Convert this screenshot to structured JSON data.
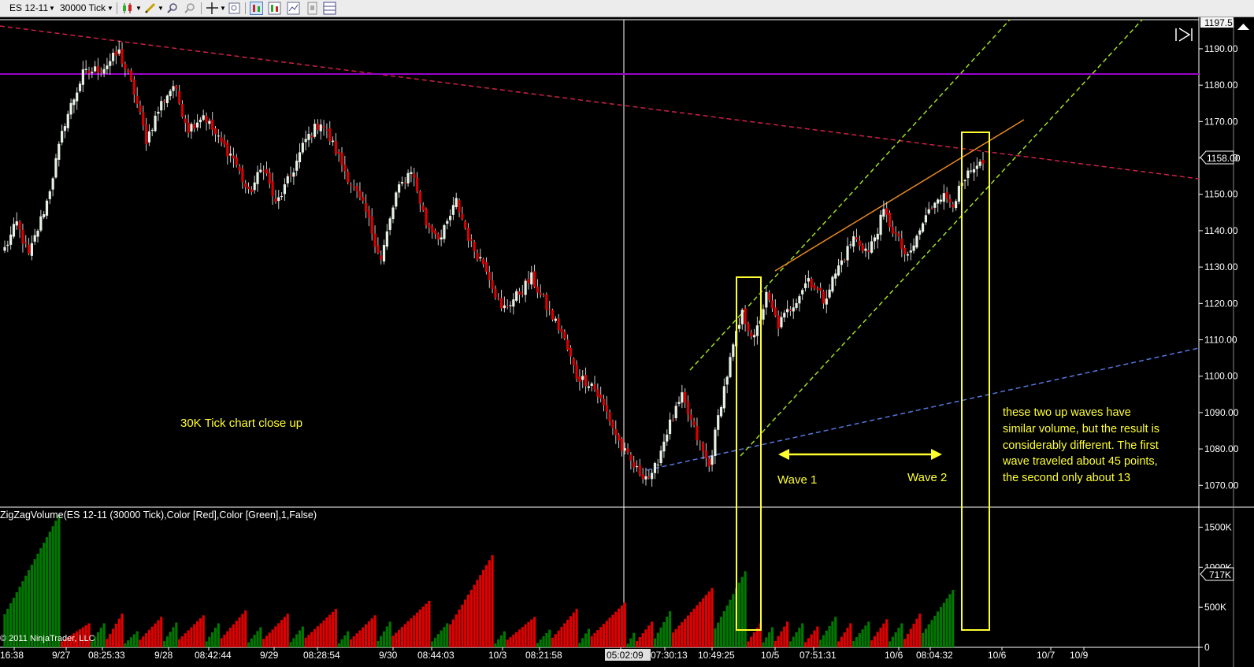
{
  "toolbar": {
    "instrument_label": "ES 12-11",
    "period_label": "30000 Tick",
    "icons": [
      "bar-style-icon",
      "draw-pencil-icon",
      "zoom-in-icon",
      "zoom-out-icon",
      "crosshair-icon",
      "data-box-icon",
      "chart-properties-icon",
      "indicators-icon",
      "strategies-icon",
      "templates-icon",
      "multi-panel-icon"
    ]
  },
  "colors": {
    "up_candle": "#e6f2e6",
    "down_candle": "#d80000",
    "vol_up": "#007800",
    "vol_down": "#e00000",
    "highlight": "#ffff30",
    "annotation_text": "#ffff30",
    "resistance_line": "#cc2244",
    "horizontal_line": "#9900cc",
    "support_line": "#5577dd",
    "channel_line": "#a0e020",
    "wedge_line": "#e88a22"
  },
  "chart_data": [
    {
      "type": "candlestick",
      "panel": "price",
      "ylim": [
        1064,
        1198
      ],
      "y_ticks": [
        "1190.00",
        "1180.00",
        "1170.00",
        "1160.00",
        "1150.00",
        "1140.00",
        "1130.00",
        "1120.00",
        "1110.00",
        "1100.00",
        "1090.00",
        "1080.00",
        "1070.00"
      ],
      "last_price_label": "1158.00",
      "top_price_label": "1197.5",
      "anchor_closes": [
        [
          0,
          1135
        ],
        [
          4,
          1142
        ],
        [
          8,
          1133
        ],
        [
          14,
          1148
        ],
        [
          20,
          1170
        ],
        [
          26,
          1183
        ],
        [
          33,
          1185
        ],
        [
          38,
          1189
        ],
        [
          43,
          1178
        ],
        [
          47,
          1165
        ],
        [
          52,
          1175
        ],
        [
          56,
          1180
        ],
        [
          61,
          1168
        ],
        [
          66,
          1172
        ],
        [
          71,
          1165
        ],
        [
          76,
          1160
        ],
        [
          81,
          1150
        ],
        [
          86,
          1158
        ],
        [
          90,
          1147
        ],
        [
          95,
          1155
        ],
        [
          100,
          1165
        ],
        [
          105,
          1170
        ],
        [
          110,
          1162
        ],
        [
          115,
          1153
        ],
        [
          120,
          1145
        ],
        [
          125,
          1132
        ],
        [
          130,
          1150
        ],
        [
          135,
          1157
        ],
        [
          140,
          1142
        ],
        [
          145,
          1138
        ],
        [
          150,
          1148
        ],
        [
          155,
          1136
        ],
        [
          160,
          1130
        ],
        [
          165,
          1118
        ],
        [
          170,
          1122
        ],
        [
          175,
          1127
        ],
        [
          180,
          1119
        ],
        [
          185,
          1112
        ],
        [
          190,
          1100
        ],
        [
          195,
          1098
        ],
        [
          200,
          1090
        ],
        [
          205,
          1080
        ],
        [
          210,
          1074
        ],
        [
          215,
          1072
        ],
        [
          220,
          1085
        ],
        [
          225,
          1094
        ],
        [
          230,
          1083
        ],
        [
          234,
          1075
        ],
        [
          238,
          1093
        ],
        [
          242,
          1108
        ],
        [
          245,
          1117
        ],
        [
          249,
          1110
        ],
        [
          253,
          1122
        ],
        [
          257,
          1114
        ],
        [
          262,
          1120
        ],
        [
          267,
          1127
        ],
        [
          272,
          1121
        ],
        [
          277,
          1130
        ],
        [
          282,
          1138
        ],
        [
          287,
          1134
        ],
        [
          292,
          1145
        ],
        [
          297,
          1137
        ],
        [
          300,
          1132
        ],
        [
          305,
          1142
        ],
        [
          310,
          1150
        ],
        [
          315,
          1148
        ],
        [
          320,
          1155
        ],
        [
          325,
          1158
        ]
      ],
      "annotations": {
        "chart_label": "30K Tick chart close up",
        "wave1": "Wave 1",
        "wave2": "Wave 2",
        "note_lines": [
          "these two up waves have",
          "similar volume, but the result is",
          "considerably different.  The first",
          "wave traveled about 45 points,",
          "the second only about 13"
        ]
      }
    },
    {
      "type": "bar",
      "panel": "volume",
      "title": "ZigZagVolume(ES 12-11 (30000 Tick),Color [Red],Color [Green],1,False)",
      "ylim": [
        0,
        1750
      ],
      "y_ticks": [
        "1500K",
        "1000K",
        "500K",
        "0"
      ],
      "y_tick_values": [
        1500,
        1000,
        500,
        0
      ],
      "last_volume_label": "717K",
      "waves": [
        {
          "dir": "up",
          "start": 0,
          "end": 18,
          "peak": 1650
        },
        {
          "dir": "down",
          "start": 19,
          "end": 28,
          "peak": 300
        },
        {
          "dir": "up",
          "start": 29,
          "end": 33,
          "peak": 300
        },
        {
          "dir": "down",
          "start": 34,
          "end": 39,
          "peak": 420
        },
        {
          "dir": "up",
          "start": 40,
          "end": 44,
          "peak": 200
        },
        {
          "dir": "down",
          "start": 45,
          "end": 52,
          "peak": 380
        },
        {
          "dir": "up",
          "start": 53,
          "end": 57,
          "peak": 310
        },
        {
          "dir": "down",
          "start": 58,
          "end": 66,
          "peak": 400
        },
        {
          "dir": "up",
          "start": 67,
          "end": 71,
          "peak": 300
        },
        {
          "dir": "down",
          "start": 72,
          "end": 80,
          "peak": 460
        },
        {
          "dir": "up",
          "start": 81,
          "end": 85,
          "peak": 250
        },
        {
          "dir": "down",
          "start": 86,
          "end": 94,
          "peak": 420
        },
        {
          "dir": "up",
          "start": 95,
          "end": 99,
          "peak": 260
        },
        {
          "dir": "down",
          "start": 100,
          "end": 110,
          "peak": 480
        },
        {
          "dir": "up",
          "start": 111,
          "end": 114,
          "peak": 200
        },
        {
          "dir": "down",
          "start": 115,
          "end": 123,
          "peak": 400
        },
        {
          "dir": "up",
          "start": 124,
          "end": 128,
          "peak": 320
        },
        {
          "dir": "down",
          "start": 129,
          "end": 141,
          "peak": 580
        },
        {
          "dir": "up",
          "start": 142,
          "end": 147,
          "peak": 300
        },
        {
          "dir": "down",
          "start": 148,
          "end": 162,
          "peak": 1150
        },
        {
          "dir": "up",
          "start": 163,
          "end": 166,
          "peak": 200
        },
        {
          "dir": "down",
          "start": 167,
          "end": 176,
          "peak": 380
        },
        {
          "dir": "up",
          "start": 177,
          "end": 181,
          "peak": 220
        },
        {
          "dir": "down",
          "start": 182,
          "end": 190,
          "peak": 480
        },
        {
          "dir": "up",
          "start": 191,
          "end": 194,
          "peak": 230
        },
        {
          "dir": "down",
          "start": 195,
          "end": 206,
          "peak": 560
        },
        {
          "dir": "up",
          "start": 207,
          "end": 209,
          "peak": 180
        },
        {
          "dir": "down",
          "start": 210,
          "end": 215,
          "peak": 320
        },
        {
          "dir": "up",
          "start": 216,
          "end": 221,
          "peak": 450
        },
        {
          "dir": "down",
          "start": 222,
          "end": 235,
          "peak": 740
        },
        {
          "dir": "up",
          "start": 236,
          "end": 246,
          "peak": 950
        },
        {
          "dir": "down",
          "start": 247,
          "end": 251,
          "peak": 300
        },
        {
          "dir": "up",
          "start": 252,
          "end": 255,
          "peak": 250
        },
        {
          "dir": "down",
          "start": 256,
          "end": 260,
          "peak": 320
        },
        {
          "dir": "up",
          "start": 261,
          "end": 265,
          "peak": 300
        },
        {
          "dir": "down",
          "start": 266,
          "end": 270,
          "peak": 260
        },
        {
          "dir": "up",
          "start": 271,
          "end": 276,
          "peak": 380
        },
        {
          "dir": "down",
          "start": 277,
          "end": 281,
          "peak": 300
        },
        {
          "dir": "up",
          "start": 282,
          "end": 287,
          "peak": 320
        },
        {
          "dir": "down",
          "start": 288,
          "end": 293,
          "peak": 350
        },
        {
          "dir": "up",
          "start": 294,
          "end": 298,
          "peak": 300
        },
        {
          "dir": "down",
          "start": 299,
          "end": 304,
          "peak": 420
        },
        {
          "dir": "up",
          "start": 305,
          "end": 315,
          "peak": 717
        }
      ]
    }
  ],
  "x_axis": {
    "labels": [
      "16:38",
      "9/27",
      "08:25:33",
      "9/28",
      "08:42:44",
      "9/29",
      "08:28:54",
      "9/30",
      "08:44:03",
      "10/3",
      "08:21:58",
      "05:02:09",
      "07:30:13",
      "10:49:25",
      "10/5",
      "07:51:31",
      "10/6",
      "08:04:32",
      "10/6",
      "10/7",
      "10/9"
    ],
    "cursor_label": "05:02:09"
  },
  "copyright": "© 2011 NinjaTrader, LLC"
}
